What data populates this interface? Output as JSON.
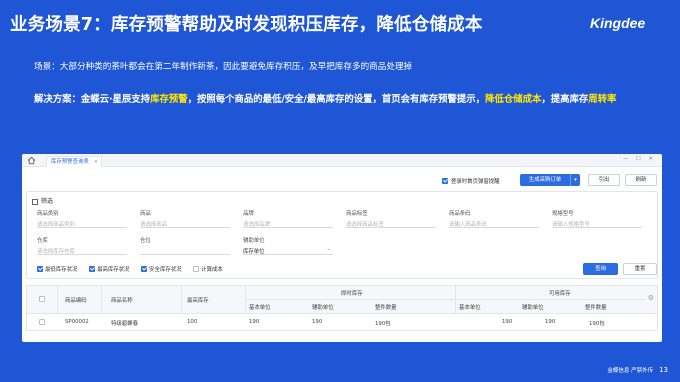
{
  "slide": {
    "title": "业务场景7：库存预警帮助及时发现积压库存，降低仓储成本",
    "brand": "Kingdee",
    "scene": "场景：大部分种类的茶叶都会在第二年制作新茶，因此要避免库存积压，及早把库存多的商品处理掉",
    "solution": {
      "p1": "解决方案：金蝶云·星辰支持",
      "h1": "库存预警",
      "p2": "，按照每个商品的最低/安全/最高库存的设置，首页会有库存预警提示，",
      "h2": "降低仓储成本",
      "p3": "，提高库存",
      "h3": "周转率"
    },
    "page_number": "13",
    "footer_text": "金蝶信息  严禁外传"
  },
  "app": {
    "tab_label": "库存预警查询表",
    "window_controls": "— ☐ ✕",
    "toolbar": {
      "checkbox_label": "登录时首页弹窗提醒",
      "primary_button": "生成采购订单",
      "export_button": "引出",
      "refresh_button": "刷新"
    },
    "filter": {
      "title": "筛选",
      "fields": [
        {
          "label": "商品类别",
          "placeholder": "请选择商品类别"
        },
        {
          "label": "商品",
          "placeholder": "请选择商品"
        },
        {
          "label": "品牌",
          "placeholder": "请选择品牌"
        },
        {
          "label": "商品标签",
          "placeholder": "请选择商品标签"
        },
        {
          "label": "商品条码",
          "placeholder": "请输入商品条码"
        },
        {
          "label": "规格型号",
          "placeholder": "请输入规格型号"
        },
        {
          "label": "仓库",
          "placeholder": "请选择库存仓库"
        },
        {
          "label": "仓位",
          "placeholder": ""
        },
        {
          "label": "辅助单位",
          "value": "库存单位"
        }
      ],
      "options": [
        {
          "label": "最低库存状况",
          "checked": true
        },
        {
          "label": "最高库存状况",
          "checked": true
        },
        {
          "label": "安全库存状况",
          "checked": true
        },
        {
          "label": "计算成本",
          "checked": false
        }
      ],
      "query_button": "查询",
      "reset_button": "重置"
    },
    "grid": {
      "headers": {
        "code": "商品编码",
        "name": "商品名称",
        "min_stock": "最高库存",
        "group_current": "即时库存",
        "group_available": "可用库存",
        "base_unit": "基本单位",
        "aux_unit": "辅助单位",
        "full_qty": "整件数量"
      },
      "rows": [
        {
          "code": "SP00002",
          "name": "特级碧螺春",
          "min_stock": "100",
          "cur_base": "190",
          "cur_aux": "190",
          "cur_full": "190包",
          "avail_base": "190",
          "avail_aux": "190",
          "avail_full": "190包"
        }
      ]
    }
  },
  "colors": {
    "background": "#1f56d6",
    "highlight": "#ffe600",
    "primary": "#2b6de0"
  }
}
